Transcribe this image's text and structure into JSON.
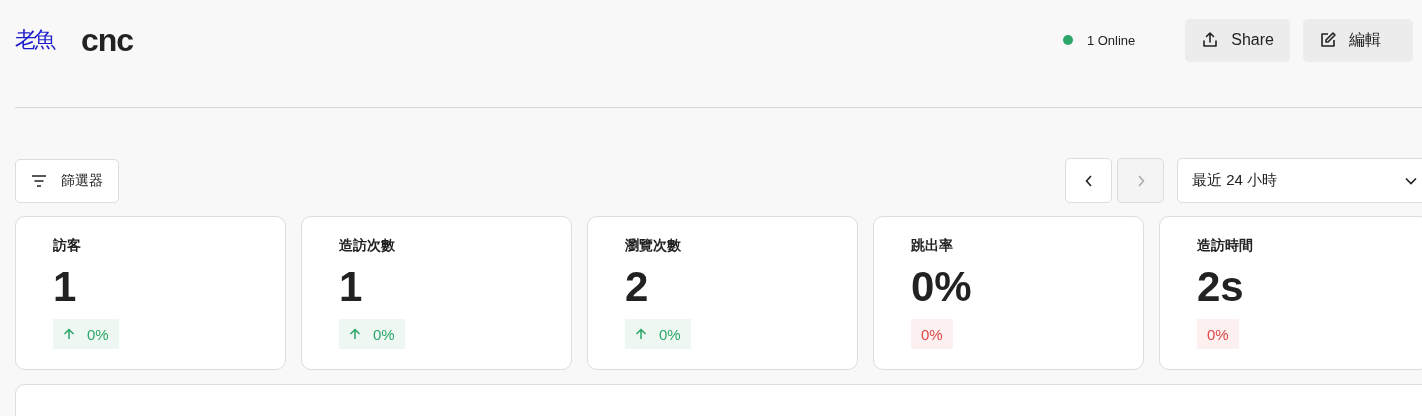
{
  "header": {
    "logo": "老魚",
    "title": "cnc",
    "online": "1 Online",
    "share": "Share",
    "edit": "編輯"
  },
  "toolbar": {
    "filter": "篩選器",
    "prev": {
      "disabled": false
    },
    "next": {
      "disabled": true
    },
    "range": "最近 24 小時"
  },
  "metrics": [
    {
      "label": "訪客",
      "value": "1",
      "change": "0%",
      "kind": "up"
    },
    {
      "label": "造訪次數",
      "value": "1",
      "change": "0%",
      "kind": "up"
    },
    {
      "label": "瀏覽次數",
      "value": "2",
      "change": "0%",
      "kind": "up"
    },
    {
      "label": "跳出率",
      "value": "0%",
      "change": "0%",
      "kind": "flat"
    },
    {
      "label": "造訪時間",
      "value": "2s",
      "change": "0%",
      "kind": "flat"
    }
  ]
}
